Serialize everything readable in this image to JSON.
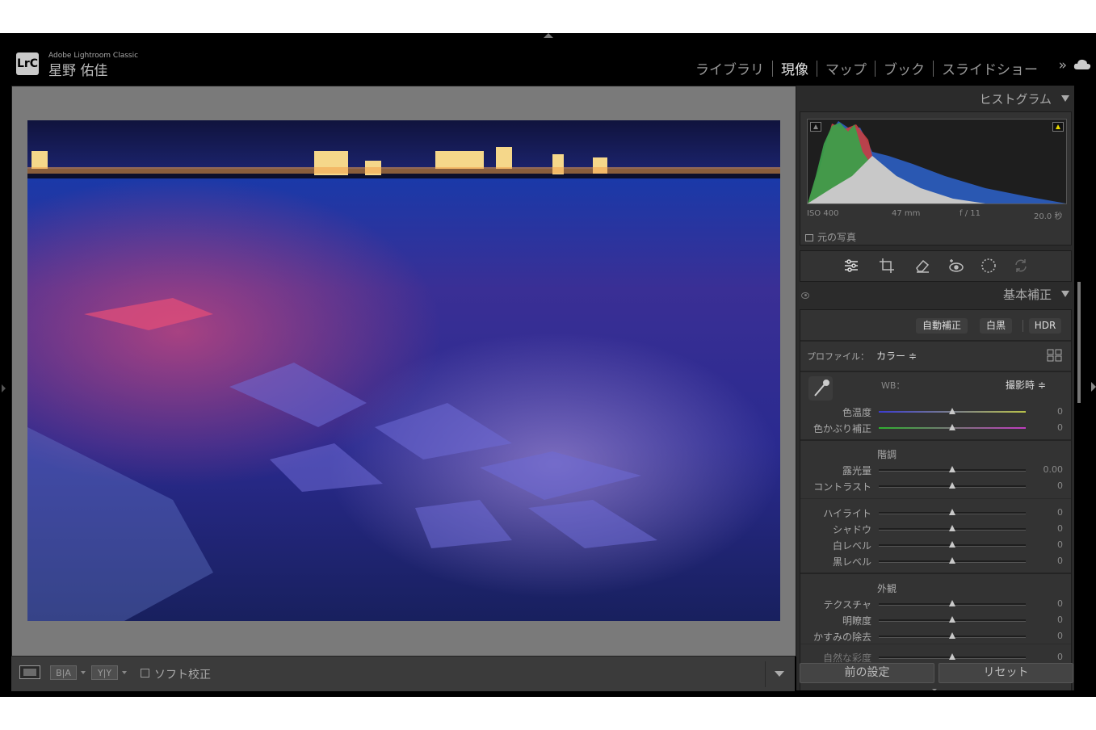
{
  "app": {
    "logo": "LrC",
    "product": "Adobe Lightroom Classic",
    "user": "星野 佑佳"
  },
  "modules": [
    {
      "label": "ライブラリ",
      "active": false
    },
    {
      "label": "現像",
      "active": true
    },
    {
      "label": "マップ",
      "active": false
    },
    {
      "label": "ブック",
      "active": false
    },
    {
      "label": "スライドショー",
      "active": false
    }
  ],
  "icons": {
    "more": "double-chevron-right-icon",
    "cloud": "cloud-icon"
  },
  "toolbar": {
    "before_after": "B|A",
    "yy": "Y|Y",
    "soft_proof": "ソフト校正"
  },
  "histogram": {
    "title": "ヒストグラム",
    "iso": "ISO 400",
    "focal": "47 mm",
    "aperture": "f / 11",
    "shutter": "20.0 秒",
    "original_photo": "元の写真"
  },
  "tools": [
    "sliders-icon",
    "crop-icon",
    "eraser-icon",
    "red-eye-icon",
    "mask-icon",
    "sync-icon"
  ],
  "basic": {
    "title": "基本補正",
    "auto": "自動補正",
    "bw": "白黒",
    "hdr": "HDR",
    "profile_label": "プロファイル：",
    "profile_value": "カラー ≑",
    "wb_label": "WB：",
    "wb_value": "撮影時 ≑",
    "tone_title": "階調",
    "presence_title": "外観",
    "sliders": {
      "temp": {
        "label": "色温度",
        "value": "0"
      },
      "tint": {
        "label": "色かぶり補正",
        "value": "0"
      },
      "exposure": {
        "label": "露光量",
        "value": "0.00"
      },
      "contrast": {
        "label": "コントラスト",
        "value": "0"
      },
      "highlights": {
        "label": "ハイライト",
        "value": "0"
      },
      "shadows": {
        "label": "シャドウ",
        "value": "0"
      },
      "whites": {
        "label": "白レベル",
        "value": "0"
      },
      "blacks": {
        "label": "黒レベル",
        "value": "0"
      },
      "texture": {
        "label": "テクスチャ",
        "value": "0"
      },
      "clarity": {
        "label": "明瞭度",
        "value": "0"
      },
      "dehaze": {
        "label": "かすみの除去",
        "value": "0"
      },
      "vibrance": {
        "label": "自然な彩度",
        "value": "0"
      }
    }
  },
  "buttons": {
    "previous": "前の設定",
    "reset": "リセット"
  }
}
